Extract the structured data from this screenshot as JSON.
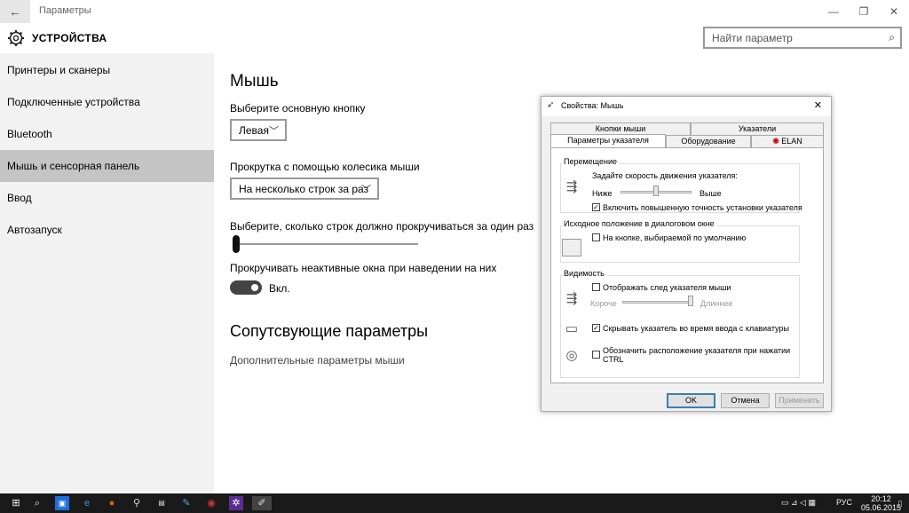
{
  "window": {
    "title": "Параметры",
    "back_glyph": "←",
    "minimize_glyph": "—",
    "maximize_glyph": "❐",
    "close_glyph": "✕"
  },
  "header": {
    "title": "УСТРОЙСТВА",
    "icon": "gear-icon",
    "search_placeholder": "Найти параметр",
    "search_icon": "search-icon"
  },
  "sidebar": {
    "items": [
      {
        "label": "Принтеры и сканеры"
      },
      {
        "label": "Подключенные устройства"
      },
      {
        "label": "Bluetooth"
      },
      {
        "label": "Мышь и сенсорная панель",
        "active": true
      },
      {
        "label": "Ввод"
      },
      {
        "label": "Автозапуск"
      }
    ]
  },
  "main": {
    "title": "Мышь",
    "primary_button_label": "Выберите основную кнопку",
    "primary_button_value": "Левая",
    "scroll_label": "Прокрутка с помощью колесика мыши",
    "scroll_value": "На несколько строк за раз",
    "lines_label": "Выберите, сколько строк должно прокручиваться за один раз",
    "lines_slider_fraction": 0.0,
    "inactive_scroll_label": "Прокручивать неактивные окна при наведении на них",
    "inactive_scroll_state": "Вкл.",
    "related_title": "Сопутсвующие параметры",
    "related_link": "Дополнительные параметры мыши"
  },
  "dialog": {
    "title": "Свойства: Мышь",
    "close_glyph": "✕",
    "tabs_row1": [
      "Кнопки мыши",
      "Указатели"
    ],
    "tabs_row2": [
      "Параметры указателя",
      "Оборудование",
      "ELAN"
    ],
    "active_tab": "Параметры указателя",
    "motion": {
      "group": "Перемещение",
      "speed_label": "Задайте скорость движения указателя:",
      "slow": "Ниже",
      "fast": "Выше",
      "speed_fraction": 0.5,
      "precision_label": "Включить повышенную точность установки указателя",
      "precision_checked": true
    },
    "snap": {
      "group": "Исходное положение в диалоговом окне",
      "label": "На кнопке, выбираемой по умолчанию",
      "checked": false
    },
    "visibility": {
      "group": "Видимость",
      "trails_label": "Отображать след указателя мыши",
      "trails_checked": false,
      "short": "Короче",
      "long": "Длиннее",
      "trail_fraction": 1.0,
      "hide_label": "Скрывать указатель во время ввода с клавиатуры",
      "hide_checked": true,
      "ctrl_label_1": "Обозначить расположение указателя при нажатии",
      "ctrl_label_2": "CTRL",
      "ctrl_checked": false
    },
    "buttons": {
      "ok": "OK",
      "cancel": "Отмена",
      "apply": "Применить"
    }
  },
  "taskbar": {
    "icons": [
      "windows-start-icon",
      "search-icon",
      "store-icon",
      "edge-icon",
      "firefox-icon",
      "search-app-icon",
      "cmd-icon",
      "pen-icon",
      "media-icon",
      "vs-icon",
      "settings-icon"
    ],
    "lang": "РУС",
    "time": "20:12",
    "date": "05.06.2015"
  },
  "colors": {
    "sidebar_bg": "#f2f2f2",
    "sidebar_active": "#c4c4c4",
    "taskbar": "#1a1a1a"
  }
}
